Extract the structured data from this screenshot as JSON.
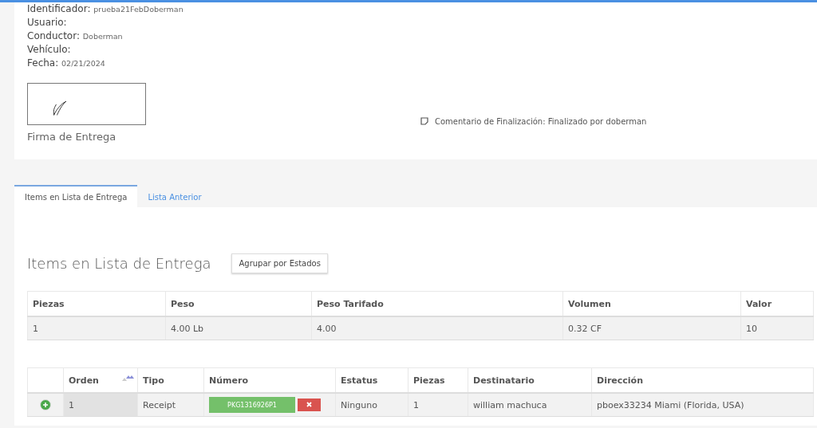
{
  "details": [
    {
      "label": "Identificador:",
      "value": "prueba21FebDoberman"
    },
    {
      "label": "Usuario:"
    },
    {
      "label": "Conductor:",
      "value": "Doberman"
    },
    {
      "label": "Vehículo:"
    },
    {
      "label": "Fecha:",
      "value": "02/21/2024"
    }
  ],
  "signature": {
    "caption": "Firma de Entrega"
  },
  "comment": "Comentario de Finalización: Finalizado por doberman",
  "tabs": [
    {
      "label": "Items en Lista de Entrega",
      "selected": true
    },
    {
      "label": "Lista Anterior",
      "selected": false
    }
  ],
  "section_title": "Items en Lista de Entrega",
  "group_button": "Agrupar por Estados",
  "summary_table": {
    "columns": [
      "Piezas",
      "Peso",
      "Peso Tarifado",
      "Volumen",
      "Valor"
    ],
    "rows": [
      [
        "1",
        "4.00 Lb",
        "4.00",
        "0.32 CF",
        "10"
      ]
    ]
  },
  "items_table": {
    "columns": [
      "Orden",
      "Tipo",
      "Número",
      "Estatus",
      "Piezas",
      "Destinatario",
      "Dirección"
    ],
    "rows": [
      {
        "orden": "1",
        "tipo": "Receipt",
        "numero": "PKG1316926P1",
        "estatus": "Ninguno",
        "piezas": "1",
        "destinatario": "william machuca",
        "direccion": "pboex33234 Miami (Florida, USA)"
      }
    ]
  }
}
